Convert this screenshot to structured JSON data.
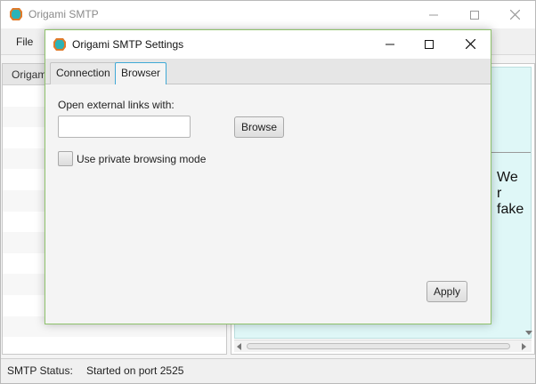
{
  "main_window": {
    "title": "Origami SMTP",
    "menu": {
      "file_label": "File"
    },
    "list_header": "Origami",
    "message_body_fragment": "We\nr\nfake",
    "status": {
      "label": "SMTP Status:",
      "value": "Started on port 2525"
    }
  },
  "dialog": {
    "title": "Origami SMTP Settings",
    "tabs": [
      {
        "label": "Connection",
        "selected": false
      },
      {
        "label": "Browser",
        "selected": true
      }
    ],
    "browser_tab": {
      "open_links_label": "Open external links with:",
      "external_program_value": "",
      "browse_label": "Browse",
      "private_mode_label": "Use private browsing mode",
      "private_mode_checked": false,
      "apply_label": "Apply"
    }
  },
  "icons": {
    "app": "origami-app-icon",
    "minimize": "minimize-icon",
    "maximize": "maximize-icon",
    "close": "close-icon"
  },
  "colors": {
    "dialog_border": "#8ec26b",
    "selected_tab_border": "#3fa9d6",
    "message_background": "#dff7f7",
    "app_icon_outer": "#e07a2a",
    "app_icon_inner": "#2bb3b8"
  }
}
